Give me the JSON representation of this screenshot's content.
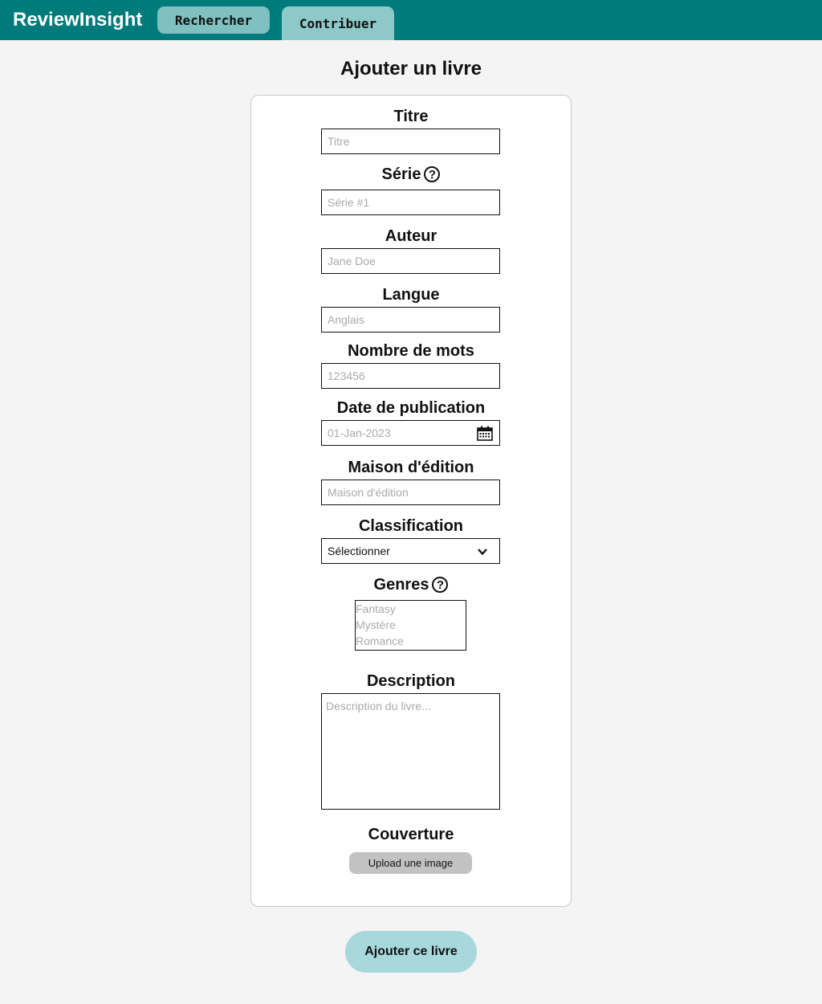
{
  "header": {
    "brand": "ReviewInsight",
    "nav": [
      {
        "label": "Rechercher"
      },
      {
        "label": "Contribuer"
      }
    ]
  },
  "page": {
    "title": "Ajouter un livre"
  },
  "form": {
    "titre": {
      "label": "Titre",
      "placeholder": "Titre"
    },
    "serie": {
      "label": "Série",
      "placeholder": "Série #1"
    },
    "auteur": {
      "label": "Auteur",
      "placeholder": "Jane Doe"
    },
    "langue": {
      "label": "Langue",
      "placeholder": "Anglais"
    },
    "mots": {
      "label": "Nombre de mots",
      "placeholder": "123456"
    },
    "date": {
      "label": "Date de publication",
      "placeholder": "01-Jan-2023"
    },
    "maison": {
      "label": "Maison d'édition",
      "placeholder": "Maison d'édition"
    },
    "classification": {
      "label": "Classification",
      "selected": "Sélectionner"
    },
    "genres": {
      "label": "Genres",
      "options": [
        "Fantasy",
        "Mystère",
        "Romance"
      ]
    },
    "description": {
      "label": "Description",
      "placeholder": "Description du livre..."
    },
    "couverture": {
      "label": "Couverture",
      "upload_label": "Upload une image"
    },
    "help_glyph": "?"
  },
  "actions": {
    "submit_label": "Ajouter ce livre"
  },
  "icons": {
    "help": "help-circle-icon",
    "calendar": "calendar-icon",
    "chevron": "chevron-down-icon"
  },
  "colors": {
    "header": "#007b7b",
    "nav_button": "#7fc0c0",
    "submit": "#a6d8dc",
    "upload": "#c2c2c2"
  }
}
